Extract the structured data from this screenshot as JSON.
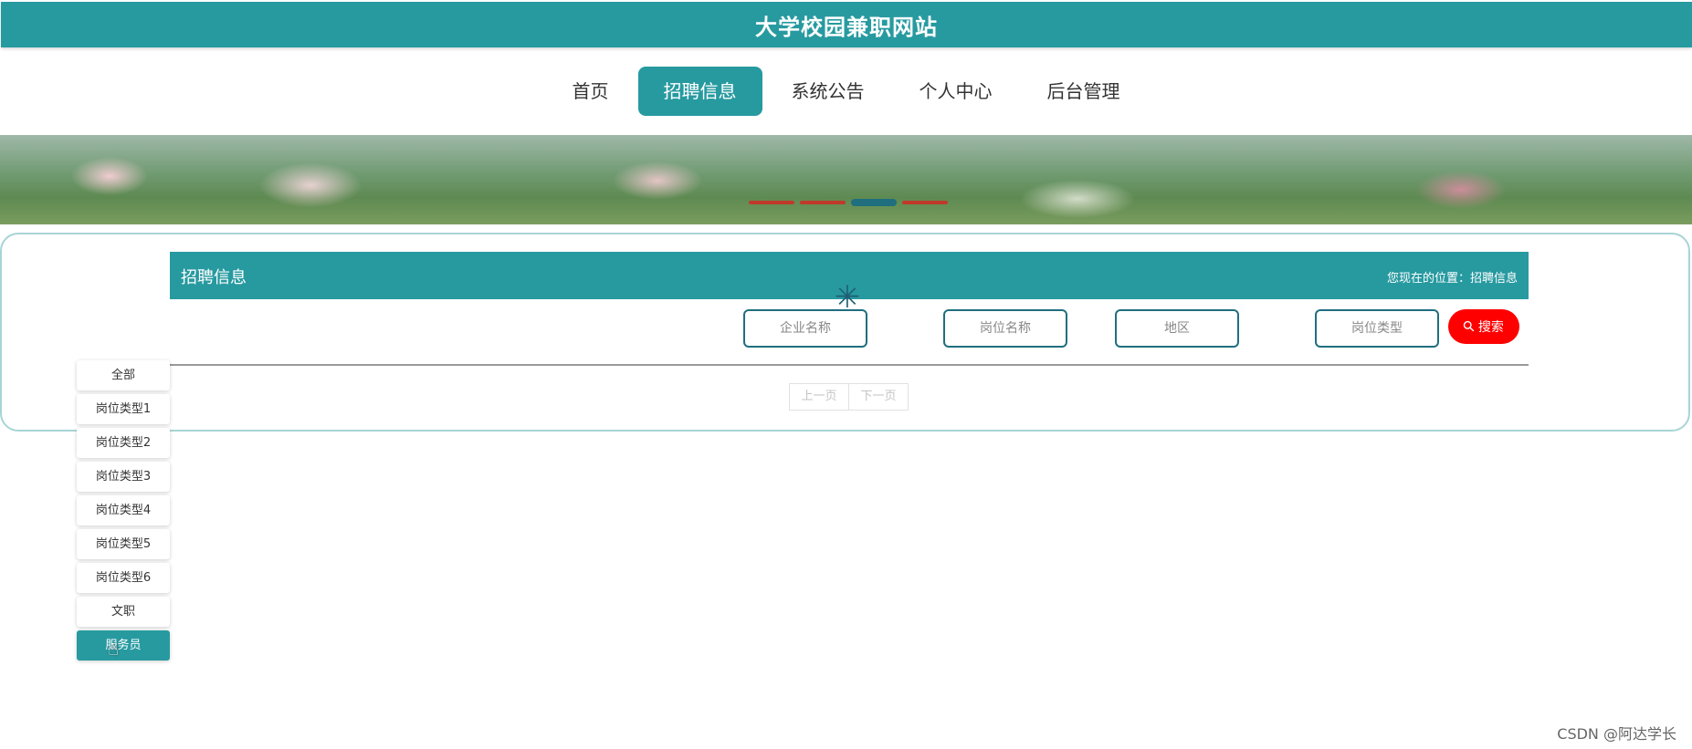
{
  "header": {
    "site_title": "大学校园兼职网站"
  },
  "nav": {
    "items": [
      {
        "label": "首页"
      },
      {
        "label": "招聘信息",
        "active": true
      },
      {
        "label": "系统公告"
      },
      {
        "label": "个人中心"
      },
      {
        "label": "后台管理"
      }
    ]
  },
  "section": {
    "title": "招聘信息",
    "location": "您现在的位置：招聘信息"
  },
  "filters": {
    "company_placeholder": "企业名称",
    "position_placeholder": "岗位名称",
    "region_placeholder": "地区",
    "type_placeholder": "岗位类型",
    "search_label": "搜索"
  },
  "pager": {
    "prev": "上一页",
    "next": "下一页"
  },
  "categories": [
    {
      "label": "全部"
    },
    {
      "label": "岗位类型1"
    },
    {
      "label": "岗位类型2"
    },
    {
      "label": "岗位类型3"
    },
    {
      "label": "岗位类型4"
    },
    {
      "label": "岗位类型5"
    },
    {
      "label": "岗位类型6"
    },
    {
      "label": "文职"
    },
    {
      "label": "服务员",
      "active": true
    }
  ],
  "watermark": "CSDN @阿达学长",
  "colors": {
    "accent": "#279aa0",
    "search": "#ff0000",
    "border": "#1f6f7f"
  },
  "icons": {
    "search": "magnifier-icon",
    "loading": "spinner-icon",
    "cursor": "hand-cursor-icon"
  }
}
